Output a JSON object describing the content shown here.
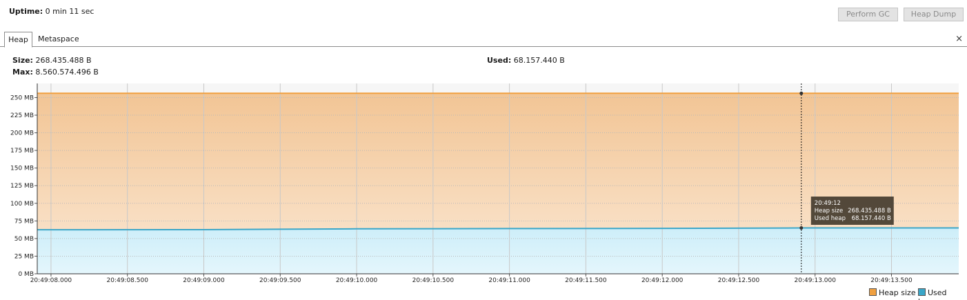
{
  "header": {
    "uptime_label": "Uptime:",
    "uptime_value": "0 min 11 sec",
    "perform_gc_label": "Perform GC",
    "heap_dump_label": "Heap Dump"
  },
  "tabs": [
    {
      "label": "Heap",
      "selected": true
    },
    {
      "label": "Metaspace",
      "selected": false
    }
  ],
  "close_icon": "×",
  "stats": {
    "size_label": "Size:",
    "size_value": "268.435.488 B",
    "max_label": "Max:",
    "max_value": "8.560.574.496 B",
    "used_label": "Used:",
    "used_value": "68.157.440 B"
  },
  "colors": {
    "heap_size": "#f0a040",
    "used_heap": "#3aa6c8",
    "tooltip_bg": "#4a4033"
  },
  "chart_data": {
    "type": "area",
    "y_unit": "MB",
    "y_ticks": [
      "0 MB",
      "25 MB",
      "50 MB",
      "75 MB",
      "100 MB",
      "125 MB",
      "150 MB",
      "175 MB",
      "200 MB",
      "225 MB",
      "250 MB"
    ],
    "x_ticks": [
      "20:49:08.000",
      "20:49:08.500",
      "20:49:09.000",
      "20:49:09.500",
      "20:49:10.000",
      "20:49:10.500",
      "20:49:11.000",
      "20:49:11.500",
      "20:49:12.000",
      "20:49:12.500",
      "20:49:13.000",
      "20:49:13.500"
    ],
    "x_range": [
      "20:49:07.910",
      "20:49:13.940"
    ],
    "ylim": [
      0,
      270
    ],
    "series": [
      {
        "name": "Heap size",
        "x": [
          "20:49:07.910",
          "20:49:09.000",
          "20:49:10.000",
          "20:49:11.000",
          "20:49:12.000",
          "20:49:12.910",
          "20:49:13.940"
        ],
        "values": [
          256,
          256,
          256,
          256,
          256,
          256,
          256
        ]
      },
      {
        "name": "Used heap",
        "x": [
          "20:49:07.910",
          "20:49:09.000",
          "20:49:10.000",
          "20:49:11.000",
          "20:49:12.000",
          "20:49:12.910",
          "20:49:13.940"
        ],
        "values": [
          62.5,
          62.6,
          63.8,
          64.2,
          64.4,
          65,
          65
        ]
      }
    ],
    "tooltip": {
      "time": "20:49:12",
      "x": "20:49:12.910",
      "rows": [
        {
          "label": "Heap size",
          "value": "268.435.488 B"
        },
        {
          "label": "Used heap",
          "value": "68.157.440 B"
        }
      ]
    },
    "legend": [
      "Heap size",
      "Used heap"
    ],
    "grid": true
  }
}
